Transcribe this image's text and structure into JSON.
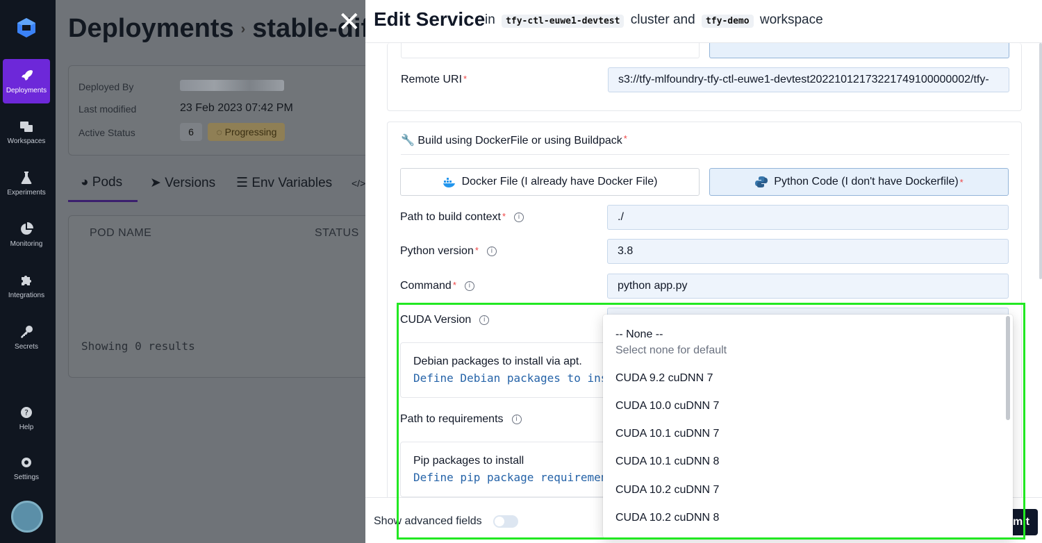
{
  "sidebar": {
    "items": [
      {
        "label": "Deployments",
        "icon": "rocket-icon"
      },
      {
        "label": "Workspaces",
        "icon": "workspaces-icon"
      },
      {
        "label": "Experiments",
        "icon": "flask-icon"
      },
      {
        "label": "Monitoring",
        "icon": "pie-chart-icon"
      },
      {
        "label": "Integrations",
        "icon": "puzzle-icon"
      },
      {
        "label": "Secrets",
        "icon": "key-icon"
      },
      {
        "label": "Help",
        "icon": "help-icon"
      },
      {
        "label": "Settings",
        "icon": "gear-icon"
      }
    ]
  },
  "background": {
    "breadcrumb_root": "Deployments",
    "breadcrumb_current": "stable-difus",
    "deployed_by_label": "Deployed By",
    "last_modified_label": "Last modified",
    "last_modified_value": "23 Feb 2023 07:42 PM",
    "active_status_label": "Active Status",
    "active_count": "6",
    "status": "Progressing",
    "tabs": [
      "Pods",
      "Versions",
      "Env Variables"
    ],
    "columns": [
      "POD NAME",
      "STATUS"
    ],
    "empty_text": "Showing 0 results"
  },
  "drawer": {
    "title": "Edit Service",
    "in_text": "in",
    "cluster": "tfy-ctl-euwe1-devtest",
    "cluster_text": "cluster and",
    "workspace": "tfy-demo",
    "workspace_text": "workspace",
    "remote_uri_label": "Remote URI",
    "remote_uri_value": "s3://tfy-mlfoundry-tfy-ctl-euwe1-devtest20221012173221749100000002/tfy-",
    "build_section_label": "Build using DockerFile or using Buildpack",
    "docker_option": "Docker File (I already have Docker File)",
    "python_option": "Python Code (I don't have Dockerfile)",
    "path_context_label": "Path to build context",
    "path_context_value": "./",
    "python_version_label": "Python version",
    "python_version_value": "3.8",
    "command_label": "Command",
    "command_value": "python app.py",
    "cuda_label": "CUDA Version",
    "debian_title": "Debian packages to install via apt.",
    "debian_link": "Define Debian packages to install vi",
    "requirements_label": "Path to requirements",
    "pip_title": "Pip packages to install",
    "pip_link": "Define pip package requirements.",
    "advanced_label": "Show advanced fields",
    "submit_label": "mit"
  },
  "cuda_dropdown": {
    "none_label": "-- None --",
    "none_hint": "Select none for default",
    "options": [
      "CUDA 9.2 cuDNN 7",
      "CUDA 10.0 cuDNN 7",
      "CUDA 10.1 cuDNN 7",
      "CUDA 10.1 cuDNN 8",
      "CUDA 10.2 cuDNN 7",
      "CUDA 10.2 cuDNN 8"
    ]
  },
  "colors": {
    "sidebar_bg": "#101620",
    "active_nav": "#6d28d9",
    "highlight_outline": "#22e822",
    "selected_option_bg": "#e6f0fb"
  }
}
